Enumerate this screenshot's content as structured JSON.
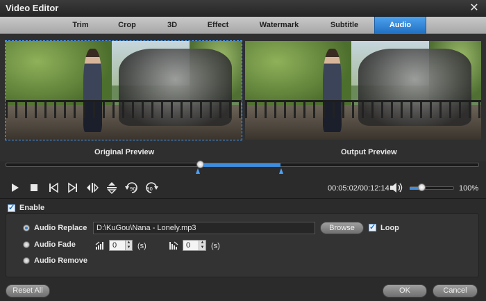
{
  "window": {
    "title": "Video Editor"
  },
  "tabs": [
    {
      "label": "Trim"
    },
    {
      "label": "Crop"
    },
    {
      "label": "3D"
    },
    {
      "label": "Effect"
    },
    {
      "label": "Watermark"
    },
    {
      "label": "Subtitle"
    },
    {
      "label": "Audio",
      "active": true
    }
  ],
  "preview": {
    "original_label": "Original Preview",
    "output_label": "Output Preview"
  },
  "timeline": {
    "start_fraction": 0.411,
    "end_fraction": 0.581,
    "current_fraction": 0.411
  },
  "playback": {
    "time_readout": "00:05:02/00:12:14",
    "volume_percent": "100%",
    "volume_fraction": 0.27,
    "controls": [
      "play-icon",
      "stop-icon",
      "previous-frame-icon",
      "next-frame-icon",
      "flip-horizontal-icon",
      "flip-vertical-icon",
      "rotate-left-90-icon",
      "rotate-right-90-icon"
    ],
    "rotate_left_label": "90",
    "rotate_right_label": "90"
  },
  "audio": {
    "enable_label": "Enable",
    "enable_checked": true,
    "options": [
      {
        "label": "Audio Replace",
        "selected": true
      },
      {
        "label": "Audio Fade",
        "selected": false
      },
      {
        "label": "Audio Remove",
        "selected": false
      }
    ],
    "path_value": "D:\\KuGou\\Nana - Lonely.mp3",
    "browse_label": "Browse",
    "loop_label": "Loop",
    "loop_checked": true,
    "fade_in_value": "0",
    "fade_out_value": "0",
    "unit_label": "(s)"
  },
  "footer": {
    "reset_label": "Reset All",
    "ok_label": "OK",
    "cancel_label": "Cancel"
  },
  "colors": {
    "accent": "#2f7fd0",
    "tab_active": "#2b80d6",
    "background": "#2b2b2b"
  }
}
